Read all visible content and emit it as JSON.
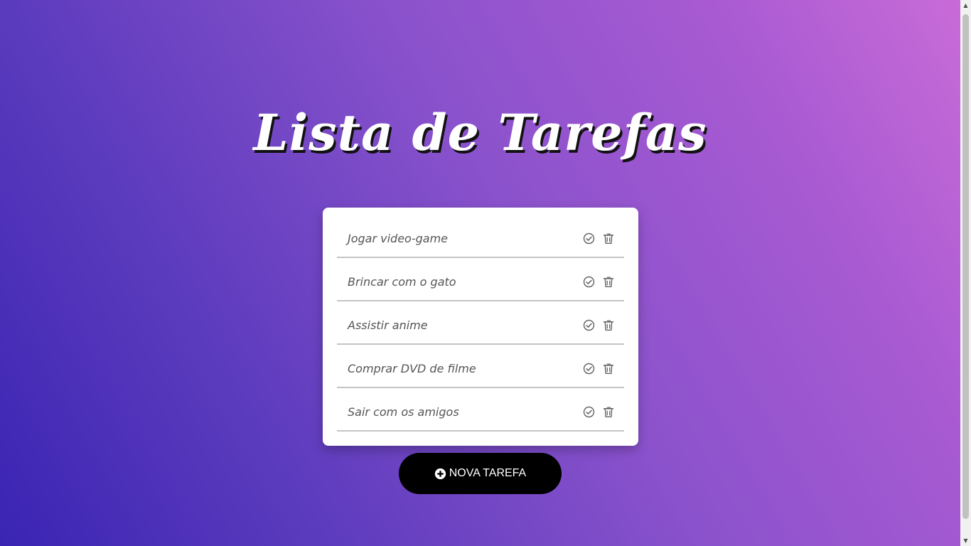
{
  "app": {
    "title": "Lista de Tarefas"
  },
  "tasks": [
    {
      "text": "Jogar video-game",
      "complete_icon": "check-circle-icon",
      "delete_icon": "trash-icon"
    },
    {
      "text": "Brincar com o gato",
      "complete_icon": "check-circle-icon",
      "delete_icon": "trash-icon"
    },
    {
      "text": "Assistir anime",
      "complete_icon": "check-circle-icon",
      "delete_icon": "trash-icon"
    },
    {
      "text": "Comprar DVD de filme",
      "complete_icon": "check-circle-icon",
      "delete_icon": "trash-icon"
    },
    {
      "text": "Sair com os amigos",
      "complete_icon": "check-circle-icon",
      "delete_icon": "trash-icon"
    }
  ],
  "new_task_button": {
    "label": "NOVA TAREFA",
    "icon": "plus-circle-icon"
  },
  "colors": {
    "gradient_start": "#3a24b3",
    "gradient_end": "#c86bd8",
    "card": "#ffffff",
    "button": "#000000",
    "icon": "#666666"
  }
}
